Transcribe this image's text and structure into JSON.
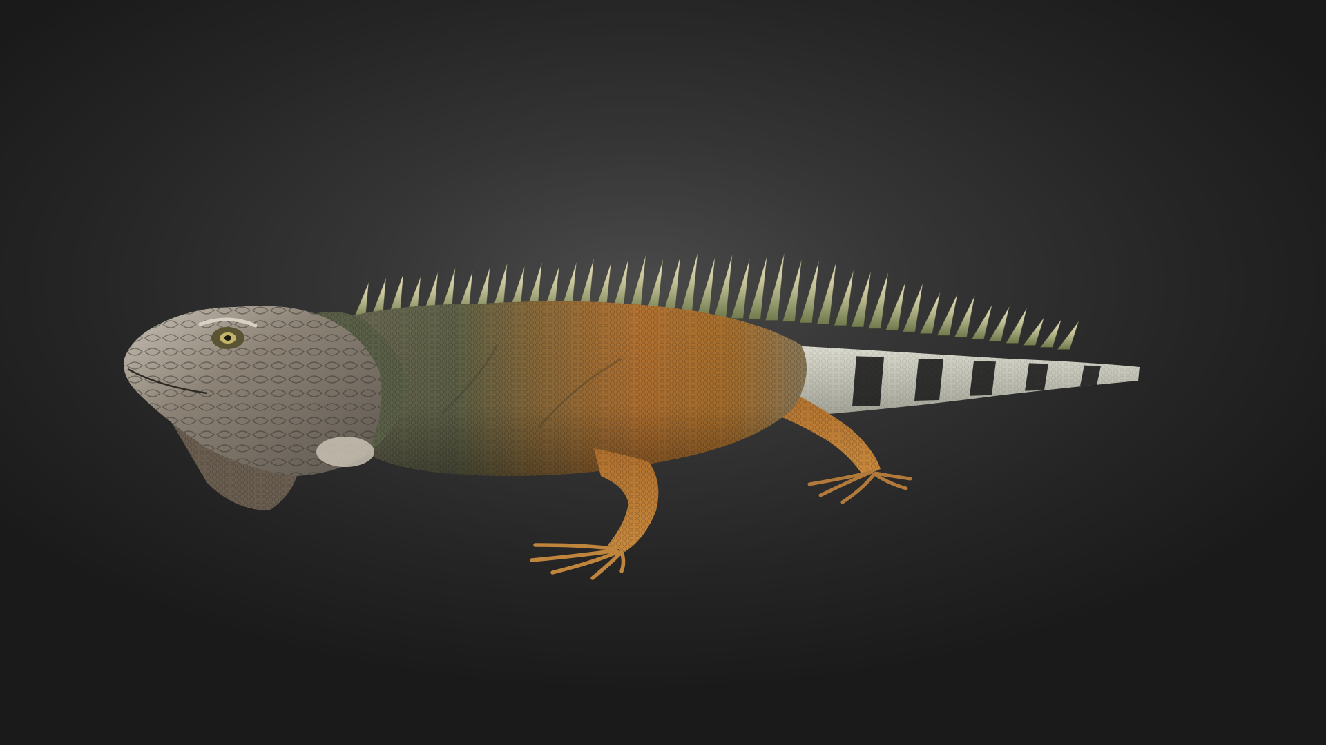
{
  "scene": {
    "subject": "iguana-3d-model",
    "colors": {
      "background_center": "#4a4a4a",
      "background_edge": "#1a1a1a",
      "body_orange": "#b5742e",
      "body_olive": "#6b6a48",
      "head_grey": "#8f8a80",
      "tail_light": "#d8d8cc",
      "tail_band": "#1e1e1e",
      "spikes": "#c8c49a"
    }
  }
}
